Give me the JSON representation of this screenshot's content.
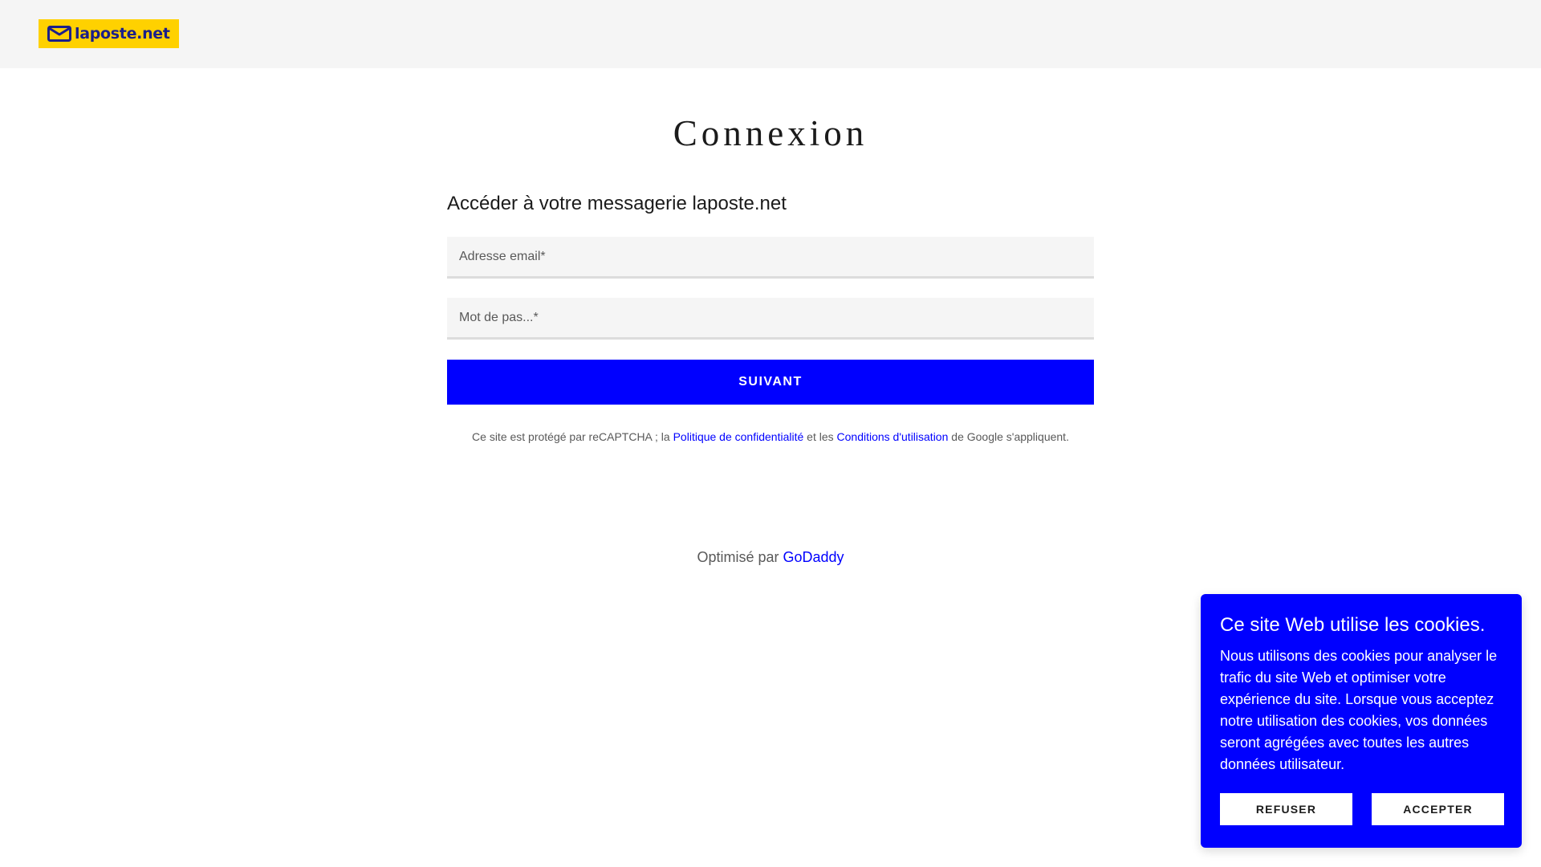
{
  "header": {
    "logo_text": "laposte.net",
    "logo_icon": "envelope-icon",
    "logo_bg": "#ffd100",
    "logo_fg": "#1b1f8a"
  },
  "main": {
    "title": "Connexion",
    "subtitle": "Accéder à votre messagerie laposte.net",
    "email_placeholder": "Adresse email*",
    "password_placeholder": "Mot de pas...*",
    "submit_label": "SUIVANT",
    "recaptcha": {
      "prefix": "Ce site est protégé par reCAPTCHA ; la ",
      "privacy_link": "Politique de confidentialité",
      "middle": " et les ",
      "terms_link": "Conditions d'utilisation",
      "suffix": " de Google s'appliquent."
    }
  },
  "footer": {
    "powered_prefix": "Optimisé par ",
    "powered_link": "GoDaddy"
  },
  "cookie_banner": {
    "title": "Ce site Web utilise les cookies.",
    "body": "Nous utilisons des cookies pour analyser le trafic du site Web et optimiser votre expérience du site. Lorsque vous acceptez notre utilisation des cookies, vos données seront agrégées avec toutes les autres données utilisateur.",
    "refuse_label": "REFUSER",
    "accept_label": "ACCEPTER"
  },
  "colors": {
    "accent": "#0000ff",
    "topbar": "#f5f5f5",
    "field_bg": "#f5f5f5"
  }
}
